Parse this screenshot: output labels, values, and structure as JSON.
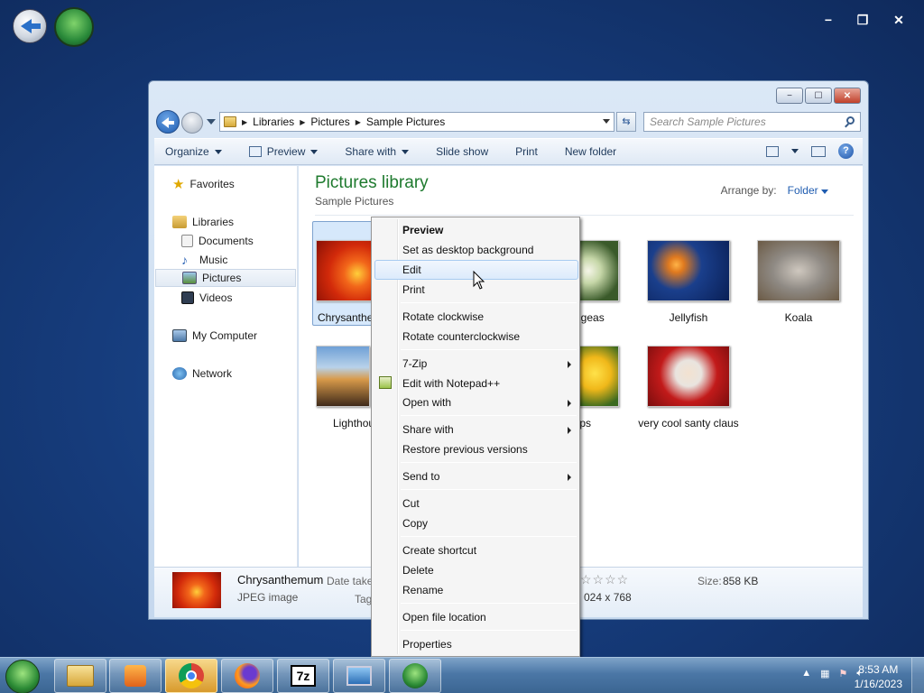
{
  "top_controls": {
    "minimize": "−",
    "restore": "❐",
    "close": "✕"
  },
  "window": {
    "caption_buttons": {
      "minimize": "−",
      "maximize": "☐",
      "close": "✕"
    },
    "address_path": [
      "Libraries",
      "Pictures",
      "Sample Pictures"
    ],
    "search_placeholder": "Search Sample Pictures",
    "toolbar": [
      "Organize",
      "Preview",
      "Share with",
      "Slide show",
      "Print",
      "New folder"
    ]
  },
  "nav": {
    "favorites": "Favorites",
    "libraries": "Libraries",
    "documents": "Documents",
    "music": "Music",
    "pictures": "Pictures",
    "videos": "Videos",
    "my_computer": "My Computer",
    "network": "Network"
  },
  "content": {
    "title": "Pictures library",
    "subtitle": "Sample Pictures",
    "arrange_label": "Arrange by:",
    "arrange_value": "Folder",
    "items": [
      {
        "label": "Chrysanthe"
      },
      {
        "label": "ngeas"
      },
      {
        "label": "Jellyfish"
      },
      {
        "label": "Koala"
      },
      {
        "label": "Lighthou"
      },
      {
        "label": "lips"
      },
      {
        "label": "very cool santy claus"
      }
    ]
  },
  "details": {
    "name": "Chrysanthemum",
    "type": "JPEG image",
    "date_label": "Date take",
    "tags_label": "Tag",
    "rating_stars": "☆☆☆☆",
    "dimensions": "024 x 768",
    "size_label": "Size:",
    "size_value": "858 KB"
  },
  "context_menu": {
    "items": [
      {
        "label": "Preview"
      },
      {
        "label": "Set as desktop background"
      },
      {
        "label": "Edit"
      },
      {
        "label": "Print"
      },
      {
        "label": "Rotate clockwise"
      },
      {
        "label": "Rotate counterclockwise"
      },
      {
        "label": "7-Zip"
      },
      {
        "label": "Edit with Notepad++"
      },
      {
        "label": "Open with"
      },
      {
        "label": "Share with"
      },
      {
        "label": "Restore previous versions"
      },
      {
        "label": "Send to"
      },
      {
        "label": "Cut"
      },
      {
        "label": "Copy"
      },
      {
        "label": "Create shortcut"
      },
      {
        "label": "Delete"
      },
      {
        "label": "Rename"
      },
      {
        "label": "Open file location"
      },
      {
        "label": "Properties"
      }
    ]
  },
  "taskbar": {
    "sevenzip_label": "7z",
    "clock_time": "8:53 AM",
    "clock_date": "1/16/2023"
  },
  "colors": {
    "library_title": "#1e7a2e",
    "link_blue": "#1f5cb0",
    "menu_hover": "#dcebfc"
  }
}
